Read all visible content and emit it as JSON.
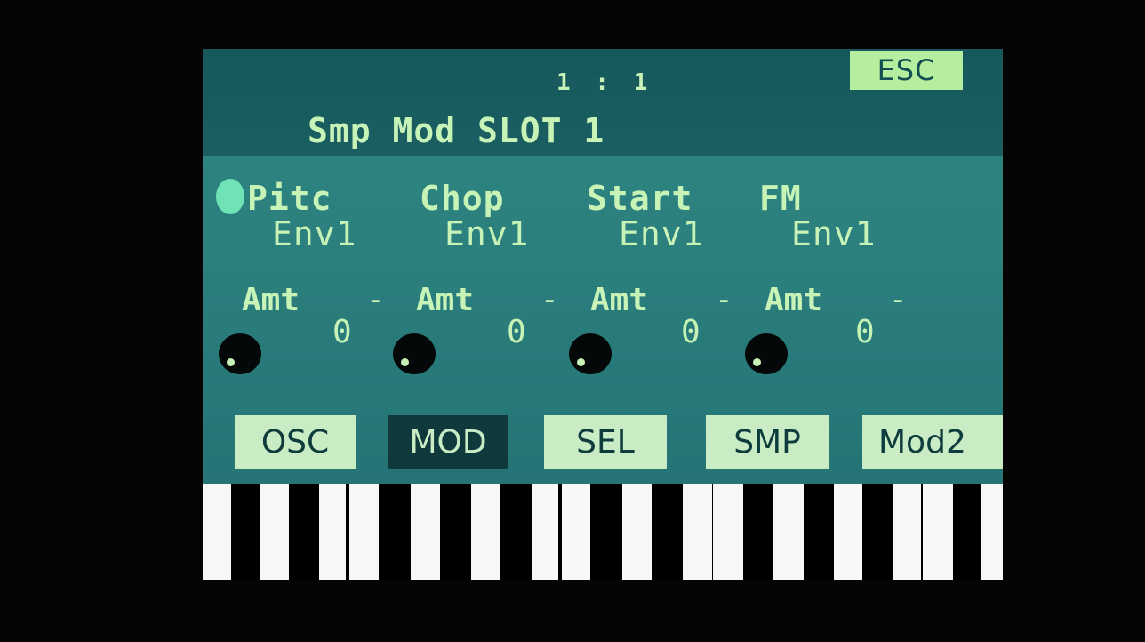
{
  "header": {
    "position": "1 : 1",
    "title": "Smp Mod SLOT 1",
    "esc_label": "ESC"
  },
  "slots": [
    {
      "name": "Pitc",
      "source": "Env1",
      "amount_label": "Amt",
      "dash": "-",
      "amount": "0"
    },
    {
      "name": "Chop",
      "source": "Env1",
      "amount_label": "Amt",
      "dash": "-",
      "amount": "0"
    },
    {
      "name": "Start",
      "source": "Env1",
      "amount_label": "Amt",
      "dash": "-",
      "amount": "0"
    },
    {
      "name": "FM",
      "source": "Env1",
      "amount_label": "Amt",
      "dash": "-",
      "amount": "0"
    }
  ],
  "tabs": [
    {
      "label": "OSC",
      "active": false
    },
    {
      "label": "MOD",
      "active": true
    },
    {
      "label": "SEL",
      "active": false
    },
    {
      "label": "SMP",
      "active": false
    },
    {
      "label": "Mod2",
      "active": false
    }
  ],
  "colors": {
    "screen_bg": "#2b7f7d",
    "header_bg": "#16585b",
    "text": "#c7f3b6",
    "esc_bg": "#b5ee9e",
    "tab_light": "#c9ecc4",
    "tab_active": "#10393b",
    "cursor": "#6fe3b6"
  }
}
